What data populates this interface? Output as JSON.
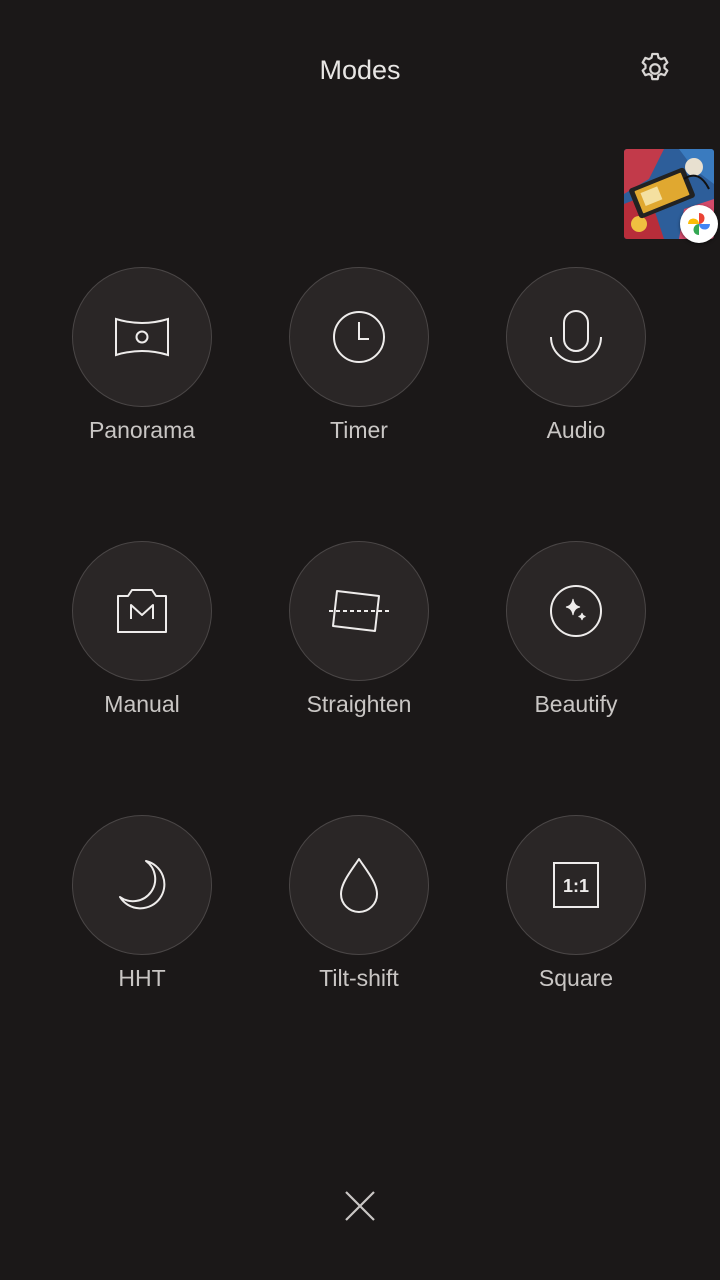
{
  "header": {
    "title": "Modes",
    "settings_icon": "gear-icon"
  },
  "recent_photo": {
    "badge_icon": "google-photos-icon"
  },
  "modes": [
    {
      "label": "Panorama",
      "icon": "panorama-icon"
    },
    {
      "label": "Timer",
      "icon": "clock-icon"
    },
    {
      "label": "Audio",
      "icon": "microphone-icon"
    },
    {
      "label": "Manual",
      "icon": "manual-icon"
    },
    {
      "label": "Straighten",
      "icon": "straighten-icon"
    },
    {
      "label": "Beautify",
      "icon": "sparkle-icon"
    },
    {
      "label": "HHT",
      "icon": "moon-icon"
    },
    {
      "label": "Tilt-shift",
      "icon": "droplet-icon"
    },
    {
      "label": "Square",
      "icon": "square-ratio-icon",
      "icon_text": "1:1"
    }
  ],
  "footer": {
    "close_icon": "close-icon"
  },
  "colors": {
    "background": "#1b1818",
    "circle": "#2a2626",
    "circle_border": "#4a4646",
    "text": "#c9c6c4"
  }
}
